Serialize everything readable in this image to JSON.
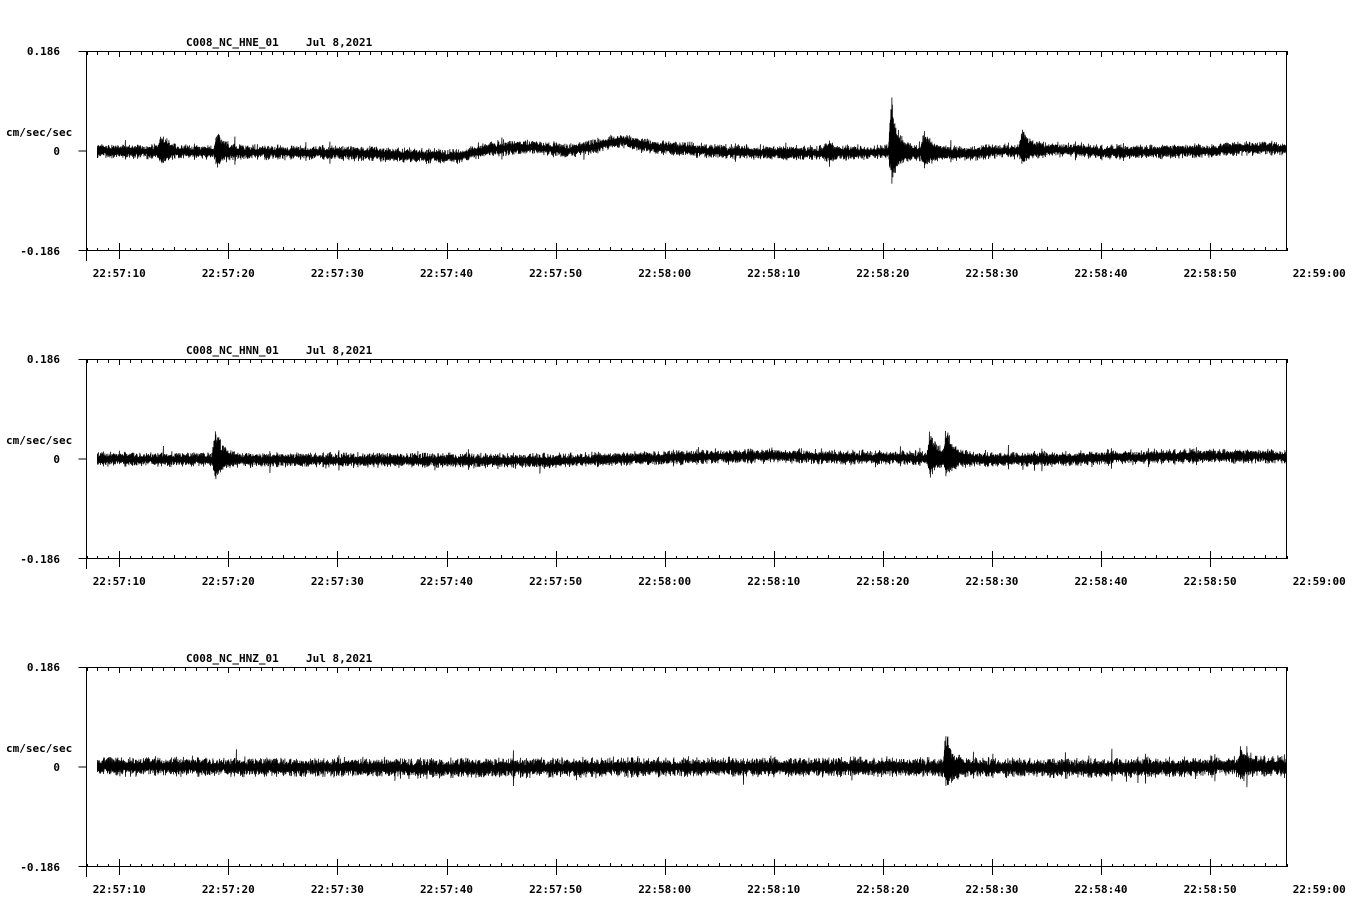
{
  "date": "Jul 8,2021",
  "time_ticks": [
    "22:57:10",
    "22:57:20",
    "22:57:30",
    "22:57:40",
    "22:57:50",
    "22:58:00",
    "22:58:10",
    "22:58:20",
    "22:58:30",
    "22:58:40",
    "22:58:50",
    "22:59:00"
  ],
  "colors": {
    "trace": "#000000",
    "axes": "#000000",
    "background": "#ffffff"
  },
  "chart_data": [
    {
      "type": "line",
      "title": "C008_NC_HNE_01",
      "date": "Jul 8,2021",
      "ylabel": "cm/sec/sec",
      "ylim": [
        -0.186,
        0.186
      ],
      "ytick_labels": [
        "0.186",
        "0",
        "-0.186"
      ],
      "xlim_seconds_after_22_57_00": [
        7,
        117
      ],
      "xtick_labels": [
        "22:57:10",
        "22:57:20",
        "22:57:30",
        "22:57:40",
        "22:57:50",
        "22:58:00",
        "22:58:10",
        "22:58:20",
        "22:58:30",
        "22:58:40",
        "22:58:50",
        "22:59:00"
      ],
      "series": [
        {
          "noise_amplitude": 0.012,
          "baseline": [
            [
              8,
              0.0
            ],
            [
              20,
              -0.002
            ],
            [
              30,
              -0.003
            ],
            [
              36,
              -0.008
            ],
            [
              41,
              -0.01
            ],
            [
              44,
              0.004
            ],
            [
              48,
              0.008
            ],
            [
              51,
              0.0
            ],
            [
              53,
              0.006
            ],
            [
              56,
              0.02
            ],
            [
              58,
              0.01
            ],
            [
              62,
              0.003
            ],
            [
              66,
              -0.002
            ],
            [
              74,
              -0.004
            ],
            [
              80,
              -0.002
            ],
            [
              83,
              -0.004
            ],
            [
              88,
              -0.004
            ],
            [
              91,
              0.0
            ],
            [
              97,
              0.003
            ],
            [
              100,
              -0.002
            ],
            [
              110,
              0.0
            ],
            [
              113,
              0.006
            ],
            [
              117,
              0.004
            ]
          ],
          "events": [
            [
              13.8,
              0.025
            ],
            [
              19.0,
              0.035
            ],
            [
              74.8,
              0.015
            ],
            [
              80.8,
              0.1
            ],
            [
              83.8,
              0.04
            ],
            [
              92.8,
              0.035
            ]
          ]
        }
      ]
    },
    {
      "type": "line",
      "title": "C008_NC_HNN_01",
      "date": "Jul 8,2021",
      "ylabel": "cm/sec/sec",
      "ylim": [
        -0.186,
        0.186
      ],
      "ytick_labels": [
        "0.186",
        "0",
        "-0.186"
      ],
      "xlim_seconds_after_22_57_00": [
        7,
        117
      ],
      "xtick_labels": [
        "22:57:10",
        "22:57:20",
        "22:57:30",
        "22:57:40",
        "22:57:50",
        "22:58:00",
        "22:58:10",
        "22:58:20",
        "22:58:30",
        "22:58:40",
        "22:58:50",
        "22:59:00"
      ],
      "series": [
        {
          "noise_amplitude": 0.012,
          "baseline": [
            [
              8,
              0.0
            ],
            [
              30,
              -0.002
            ],
            [
              50,
              -0.003
            ],
            [
              64,
              0.004
            ],
            [
              70,
              0.006
            ],
            [
              75,
              0.003
            ],
            [
              82,
              0.002
            ],
            [
              90,
              -0.001
            ],
            [
              96,
              0.0
            ],
            [
              102,
              0.003
            ],
            [
              110,
              0.006
            ],
            [
              117,
              0.004
            ]
          ],
          "events": [
            [
              18.8,
              0.06
            ],
            [
              84.3,
              0.05
            ],
            [
              85.8,
              0.055
            ]
          ]
        }
      ]
    },
    {
      "type": "line",
      "title": "C008_NC_HNZ_01",
      "date": "Jul 8,2021",
      "ylabel": "cm/sec/sec",
      "ylim": [
        -0.186,
        0.186
      ],
      "ytick_labels": [
        "0.186",
        "0",
        "-0.186"
      ],
      "xlim_seconds_after_22_57_00": [
        7,
        117
      ],
      "xtick_labels": [
        "22:57:10",
        "22:57:20",
        "22:57:30",
        "22:57:40",
        "22:57:50",
        "22:58:00",
        "22:58:10",
        "22:58:20",
        "22:58:30",
        "22:58:40",
        "22:58:50",
        "22:59:00"
      ],
      "series": [
        {
          "noise_amplitude": 0.016,
          "baseline": [
            [
              8,
              0.002
            ],
            [
              20,
              0.0
            ],
            [
              40,
              -0.002
            ],
            [
              60,
              0.0
            ],
            [
              80,
              0.0
            ],
            [
              100,
              -0.002
            ],
            [
              117,
              0.002
            ]
          ],
          "events": [
            [
              85.8,
              0.055
            ],
            [
              112.8,
              0.03
            ]
          ]
        }
      ]
    }
  ]
}
